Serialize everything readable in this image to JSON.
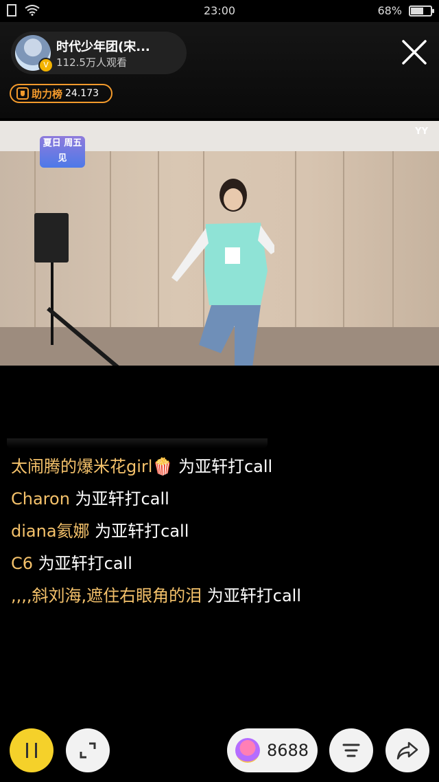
{
  "status_bar": {
    "time": "23:00",
    "battery_percent": "68%",
    "battery_level": 0.68
  },
  "anchor": {
    "name": "时代少年团(宋...",
    "viewers": "112.5万人观看",
    "badge": "V"
  },
  "rank": {
    "label": "助力榜",
    "value": "24.173"
  },
  "video": {
    "watermark": "YY",
    "logo_text": "夏日 周五见"
  },
  "chat": [
    {
      "user": "太闹腾的爆米花girl🍿",
      "text": " 为亚轩打call"
    },
    {
      "user": "Charon",
      "text": " 为亚轩打call"
    },
    {
      "user": "diana氦娜",
      "text": " 为亚轩打call"
    },
    {
      "user": "C6",
      "text": " 为亚轩打call"
    },
    {
      "user": ",,,,斜刘海,遮住右眼角的泪",
      "text": " 为亚轩打call"
    }
  ],
  "bottom_bar": {
    "gift_count": "8688"
  },
  "colors": {
    "accent_yellow": "#f5d12a",
    "username": "#f5c26b",
    "rank_orange": "#f39a2c"
  },
  "icons": [
    "wifi-icon",
    "close-icon",
    "pause-icon",
    "fullscreen-icon",
    "gift-icon",
    "menu-icon",
    "share-icon"
  ]
}
